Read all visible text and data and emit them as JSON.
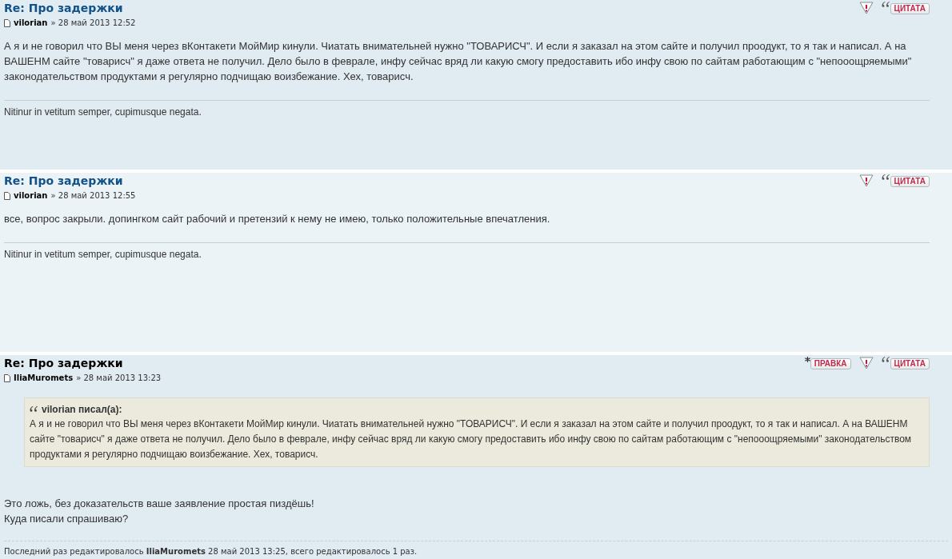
{
  "posts": [
    {
      "title": "Re: Про задержки",
      "title_is_link": true,
      "author": "vilorian",
      "date": "» 28 май 2013 12:52",
      "buttons": [
        {
          "kind": "report"
        },
        {
          "kind": "quote",
          "label": "ЦИТАТА"
        }
      ],
      "body": [
        "А я и не говорил что ВЫ меня через вКонтакети МойМир кинули. Чиатать внимательней нужно \"ТОВАРИСЧ\". И если я заказал на этом сайте и получил проодукт, то я так и написал. А на ВАШЕНМ сайте \"товарисч\" я даже ответа не получил. Дело было в феврале, инфу сейчас вряд ли какую смогу предоставить ибо инфу свою по сайтам работающим с \"непооощряемыми\" законодательством продуктами я регулярно подчищаю воизбежание. Хех, товарисч."
      ],
      "signature": "Nitinur in vetitum semper, cupimusque negata."
    },
    {
      "title": "Re: Про задержки",
      "title_is_link": true,
      "author": "vilorian",
      "date": "» 28 май 2013 12:55",
      "buttons": [
        {
          "kind": "report"
        },
        {
          "kind": "quote",
          "label": "ЦИТАТА"
        }
      ],
      "body": [
        "все, вопрос закрыли. допингком сайт рабочий и претензий к нему не имею, только положительные впечатления."
      ],
      "signature": "Nitinur in vetitum semper, cupimusque negata."
    },
    {
      "title": "Re: Про задержки",
      "title_is_link": false,
      "author": "IliaMuromets",
      "date": "» 28 май 2013 13:23",
      "buttons": [
        {
          "kind": "edit",
          "label": "ПРАВКА"
        },
        {
          "kind": "report"
        },
        {
          "kind": "quote",
          "label": "ЦИТАТА"
        }
      ],
      "quote": {
        "cite": "vilorian писал(а):",
        "text": "А я и не говорил что ВЫ меня через вКонтакети МойМир кинули. Чиатать внимательней нужно \"ТОВАРИСЧ\". И если я заказал на этом сайте и получил проодукт, то я так и написал. А на ВАШЕНМ сайте \"товарисч\" я даже ответа не получил. Дело было в феврале, инфу сейчас вряд ли какую смогу предоставить ибо инфу свою по сайтам работающим с \"непооощряемыми\" законодательством продуктами я регулярно подчищаю воизбежание. Хех, товарисч."
      },
      "body": [
        "Это ложь, без доказательств ваше заявление простая пиздёшь!",
        "Куда писали спрашиваю?"
      ],
      "edit_notice": "Последний раз редактировалось **IliaMuromets** 28 май 2013 13:25, всего редактировалось 1 раз."
    }
  ]
}
